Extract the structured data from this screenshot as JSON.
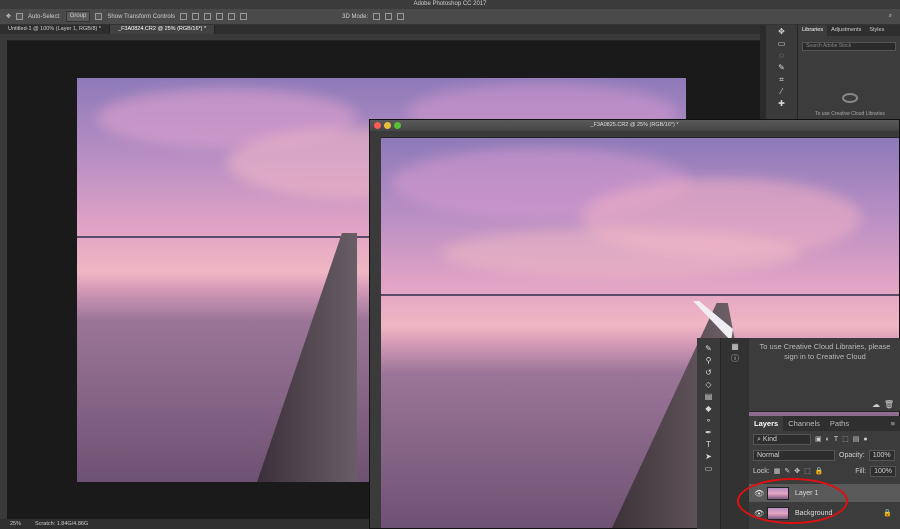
{
  "app": {
    "title": "Adobe Photoshop CC 2017"
  },
  "options": {
    "auto_select": "Auto-Select:",
    "group": "Group",
    "show_transform": "Show Transform Controls",
    "mode3d": "3D Mode:"
  },
  "tabs": [
    {
      "label": "Untitled-1 @ 100% (Layer 1, RGB/8) *"
    },
    {
      "label": "_F3A0824.CR2 @ 25% (RGB/16*) *"
    }
  ],
  "status": {
    "zoom": "25%",
    "size": "Scratch: 1.84G/4.86G"
  },
  "window2": {
    "title": "_F3A0825.CR2 @ 25% (RGB/16*) *"
  },
  "libraries": {
    "tabs": [
      "Libraries",
      "Adjustments",
      "Styles"
    ],
    "search_placeholder": "Search Adobe Stock",
    "message_small": "To use Creative Cloud Libraries",
    "message": "To use Creative Cloud Libraries, please sign in to Creative Cloud"
  },
  "layers_panel": {
    "tabs": [
      "Layers",
      "Channels",
      "Paths"
    ],
    "kind": "Kind",
    "blend_mode": "Normal",
    "opacity_label": "Opacity:",
    "opacity_value": "100%",
    "lock_label": "Lock:",
    "fill_label": "Fill:",
    "fill_value": "100%",
    "layers": [
      {
        "name": "Layer 1"
      },
      {
        "name": "Background"
      }
    ]
  },
  "colors": {
    "highlight_circle": "#e01010",
    "panel_bg": "#3c3c3c"
  }
}
